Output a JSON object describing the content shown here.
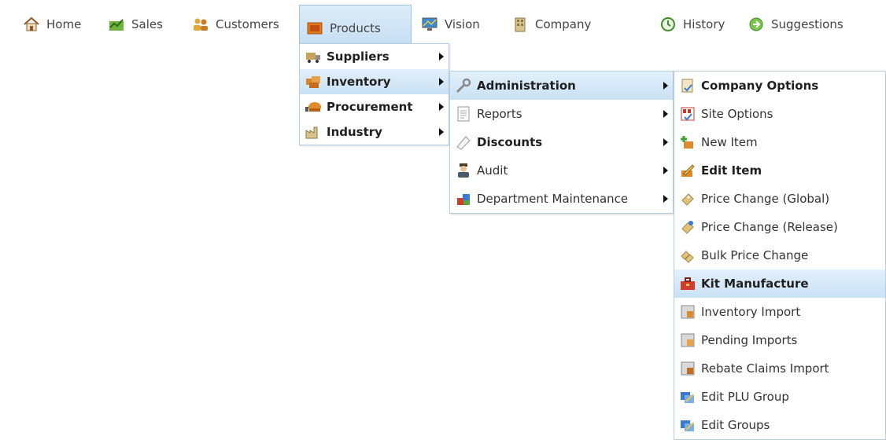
{
  "nav": {
    "tabs": [
      {
        "label": "Home",
        "icon": "home-icon"
      },
      {
        "label": "Sales",
        "icon": "sales-chart-icon"
      },
      {
        "label": "Customers",
        "icon": "customers-icon"
      },
      {
        "label": "Products",
        "icon": "products-icon"
      },
      {
        "label": "Vision",
        "icon": "vision-monitor-icon"
      },
      {
        "label": "Company",
        "icon": "company-building-icon"
      },
      {
        "label": "History",
        "icon": "history-icon"
      },
      {
        "label": "Suggestions",
        "icon": "suggestions-icon"
      }
    ]
  },
  "products_menu": {
    "items": [
      {
        "label": "Suppliers",
        "icon": "suppliers-truck-icon"
      },
      {
        "label": "Inventory",
        "icon": "inventory-boxes-icon"
      },
      {
        "label": "Procurement",
        "icon": "procurement-icon"
      },
      {
        "label": "Industry",
        "icon": "industry-factory-icon"
      }
    ]
  },
  "inventory_menu": {
    "items": [
      {
        "label": "Administration",
        "icon": "wrench-icon"
      },
      {
        "label": "Reports",
        "icon": "report-page-icon"
      },
      {
        "label": "Discounts",
        "icon": "discount-tag-icon"
      },
      {
        "label": "Audit",
        "icon": "auditor-person-icon"
      },
      {
        "label": "Department Maintenance",
        "icon": "department-blocks-icon"
      }
    ]
  },
  "administration_menu": {
    "items": [
      {
        "label": "Company Options",
        "icon": "company-options-icon"
      },
      {
        "label": "Site Options",
        "icon": "site-options-icon"
      },
      {
        "label": "New Item",
        "icon": "new-item-plus-icon"
      },
      {
        "label": "Edit Item",
        "icon": "edit-item-pencil-icon"
      },
      {
        "label": "Price Change (Global)",
        "icon": "price-change-global-icon"
      },
      {
        "label": "Price Change (Release)",
        "icon": "price-change-release-icon"
      },
      {
        "label": "Bulk Price Change",
        "icon": "bulk-price-change-icon"
      },
      {
        "label": "Kit Manufacture",
        "icon": "toolbox-icon"
      },
      {
        "label": "Inventory Import",
        "icon": "inventory-import-icon"
      },
      {
        "label": "Pending Imports",
        "icon": "pending-imports-icon"
      },
      {
        "label": "Rebate Claims Import",
        "icon": "rebate-claims-import-icon"
      },
      {
        "label": "Edit PLU Group",
        "icon": "edit-plu-group-icon"
      },
      {
        "label": "Edit Groups",
        "icon": "edit-groups-icon"
      }
    ]
  },
  "colors": {
    "active_tab_bg": "#c4ddf2",
    "menu_hover_bg": "#c9e1f4",
    "menu_border": "#b9cde0"
  }
}
